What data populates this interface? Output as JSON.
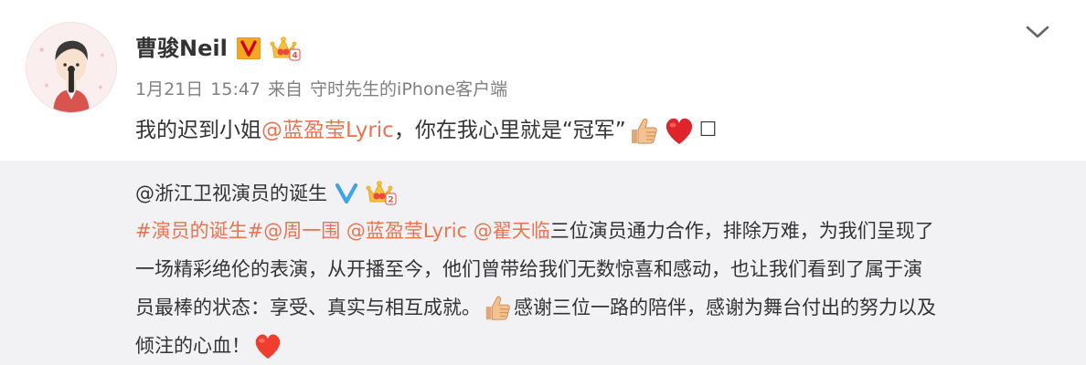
{
  "post": {
    "username": "曹骏Neil",
    "verified_badge_icon": "v-verified-icon",
    "member_badge_icon": "crown-member-icon",
    "member_level": "4",
    "date": "1月21日",
    "time": "15:47",
    "source_prefix": "来自",
    "source": "守时先生的iPhone客户端",
    "text_before_mention": "我的迟到小姐",
    "mention": "@蓝盈莹Lyric",
    "text_after_mention": "，你在我心里就是“冠军”",
    "emojis": [
      "thumbs-up-icon",
      "red-heart-icon"
    ],
    "trailing_glyph": "☐"
  },
  "repost": {
    "author": "@浙江卫视演员的诞生",
    "verified_badge_icon": "v-blue-verified-icon",
    "member_badge_icon": "crown-member-icon",
    "member_level": "2",
    "hashtag": "#演员的诞生#",
    "mention_1": "@周一围",
    "mention_2": "@蓝盈莹Lyric",
    "mention_3": "@翟天临",
    "line1_text": " 三位演员通力合作，排除万难，为我们呈现了",
    "line2_text": "一场精彩绝伦的表演，从开播至今，他们曾带给我们无数惊喜和感动，也让我们看到了属于演",
    "line3_text_before_emoji": "员最棒的状态：享受、真实与相互成就。",
    "line3_text_after_emoji": "感谢三位一路的陪伴，感谢为舞台付出的努力以及",
    "line4_text": "倾注的心血！",
    "emojis": [
      "thumbs-up-icon",
      "red-heart-icon"
    ]
  },
  "colors": {
    "link": "#eb7350",
    "meta_gray": "#808080",
    "repost_bg": "#f2f2f5",
    "verified_orange": "#f5a623",
    "verified_blue": "#3fa3e8"
  }
}
